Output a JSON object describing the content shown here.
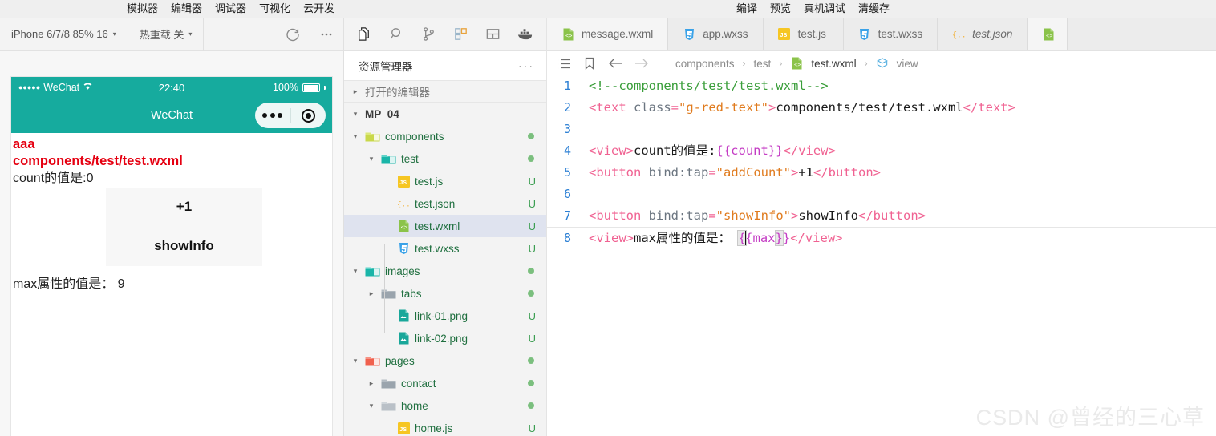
{
  "menubar": {
    "left_items": [
      "模拟器",
      "编辑器",
      "调试器",
      "可视化",
      "云开发"
    ],
    "right_items": [
      "编译",
      "预览",
      "真机调试",
      "清缓存"
    ]
  },
  "toolbar": {
    "device_label": "iPhone 6/7/8 85% 16",
    "hotreload_label": "热重载 关",
    "refresh_icon": "refresh-icon",
    "more_icon": "more-horizontal-icon",
    "caret": "▾"
  },
  "activitybar": {
    "icons": [
      "files-icon",
      "search-icon",
      "source-control-icon",
      "extensions-icon",
      "layout-icon",
      "docker-icon"
    ]
  },
  "tabs": [
    {
      "label": "message.wxml",
      "icon": "wxml-file-icon",
      "italic": false,
      "active": false
    },
    {
      "label": "app.wxss",
      "icon": "wxss-file-icon",
      "italic": false,
      "active": false
    },
    {
      "label": "test.js",
      "icon": "js-file-icon",
      "italic": false,
      "active": false
    },
    {
      "label": "test.wxss",
      "icon": "wxss-file-icon",
      "italic": false,
      "active": false
    },
    {
      "label": "test.json",
      "icon": "json-file-icon",
      "italic": true,
      "active": false
    },
    {
      "label": "",
      "icon": "wxml-file-icon",
      "italic": false,
      "active": true
    }
  ],
  "simulator": {
    "status": {
      "carrier": "WeChat",
      "signal_dots": "●●●●●",
      "wifi_icon": "wifi-icon",
      "time": "22:40",
      "battery_percent": "100%"
    },
    "nav": {
      "title": "WeChat",
      "capsule_more_icon": "capsule-more-icon",
      "capsule_target_icon": "capsule-target-icon"
    },
    "content": {
      "red_line_1": "aaa",
      "red_line_2": "components/test/test.wxml",
      "count_text": "count的值是:0",
      "button_plus_one": "+1",
      "button_show_info": "showInfo",
      "max_text": "max属性的值是： 9"
    },
    "colors": {
      "theme_teal": "#16ab9e",
      "red_text": "#e50011"
    }
  },
  "explorer": {
    "title": "资源管理器",
    "more_icon": "more-horizontal-icon",
    "open_editors_label": "打开的编辑器",
    "project_root": "MP_04",
    "tree": [
      {
        "label": "components",
        "depth": 1,
        "type": "folder",
        "icon": "folder-components-icon",
        "arrow": "▾",
        "status": "dot",
        "selected": false
      },
      {
        "label": "test",
        "depth": 2,
        "type": "folder",
        "icon": "folder-test-icon",
        "arrow": "▾",
        "status": "dot",
        "selected": false
      },
      {
        "label": "test.js",
        "depth": 3,
        "type": "file",
        "icon": "js-file-icon",
        "arrow": "",
        "status": "U",
        "selected": false
      },
      {
        "label": "test.json",
        "depth": 3,
        "type": "file",
        "icon": "json-file-icon",
        "arrow": "",
        "status": "U",
        "selected": false
      },
      {
        "label": "test.wxml",
        "depth": 3,
        "type": "file",
        "icon": "wxml-file-icon",
        "arrow": "",
        "status": "U",
        "selected": true
      },
      {
        "label": "test.wxss",
        "depth": 3,
        "type": "file",
        "icon": "wxss-file-icon",
        "arrow": "",
        "status": "U",
        "selected": false
      },
      {
        "label": "images",
        "depth": 1,
        "type": "folder",
        "icon": "folder-images-icon",
        "arrow": "▾",
        "status": "dot",
        "selected": false
      },
      {
        "label": "tabs",
        "depth": 2,
        "type": "folder",
        "icon": "folder-plain-icon",
        "arrow": "▸",
        "status": "dot",
        "selected": false
      },
      {
        "label": "link-01.png",
        "depth": 3,
        "type": "file",
        "icon": "image-file-icon",
        "arrow": "",
        "status": "U",
        "selected": false
      },
      {
        "label": "link-02.png",
        "depth": 3,
        "type": "file",
        "icon": "image-file-icon",
        "arrow": "",
        "status": "U",
        "selected": false
      },
      {
        "label": "pages",
        "depth": 1,
        "type": "folder",
        "icon": "folder-pages-icon",
        "arrow": "▾",
        "status": "dot",
        "selected": false
      },
      {
        "label": "contact",
        "depth": 2,
        "type": "folder",
        "icon": "folder-plain-icon",
        "arrow": "▸",
        "status": "dot",
        "selected": false
      },
      {
        "label": "home",
        "depth": 2,
        "type": "folder",
        "icon": "folder-open-icon",
        "arrow": "▾",
        "status": "dot",
        "selected": false
      },
      {
        "label": "home.js",
        "depth": 3,
        "type": "file",
        "icon": "js-file-icon",
        "arrow": "",
        "status": "U",
        "selected": false
      }
    ]
  },
  "breadcrumb": {
    "list_icon": "outline-list-icon",
    "bookmark_icon": "bookmark-icon",
    "back_icon": "arrow-left-icon",
    "forward_icon": "arrow-right-icon",
    "items": [
      "components",
      "test",
      "test.wxml",
      "view"
    ],
    "separator": "›"
  },
  "editor": {
    "lines": [
      {
        "number": "1"
      },
      {
        "number": "2"
      },
      {
        "number": "3"
      },
      {
        "number": "4"
      },
      {
        "number": "5"
      },
      {
        "number": "6"
      },
      {
        "number": "7"
      },
      {
        "number": "8"
      }
    ],
    "code": {
      "l1_comment": "<!--components/test/test.wxml-->",
      "l2_open": "<text",
      "l2_attr": " class",
      "l2_eq": "=",
      "l2_val": "\"g-red-text\"",
      "l2_gt": ">",
      "l2_text": "components/test/test.wxml",
      "l2_close": "</text>",
      "l4_open": "<view>",
      "l4_text": "count的值是:",
      "l4_mustache": "{{count}}",
      "l4_close": "</view>",
      "l5_open": "<button",
      "l5_attr": " bind:tap",
      "l5_eq": "=",
      "l5_val": "\"addCount\"",
      "l5_gt": ">",
      "l5_text": "+1",
      "l5_close": "</button>",
      "l7_open": "<button",
      "l7_attr": " bind:tap",
      "l7_eq": "=",
      "l7_val": "\"showInfo\"",
      "l7_gt": ">",
      "l7_text": "showInfo",
      "l7_close": "</button>",
      "l8_open": "<view>",
      "l8_text": "max属性的值是： ",
      "l8_b1": "{",
      "l8_mustache": "{max",
      "l8_b2": "}",
      "l8_b3": "}",
      "l8_close": "</view>"
    }
  },
  "watermark": "CSDN @曾经的三心草"
}
